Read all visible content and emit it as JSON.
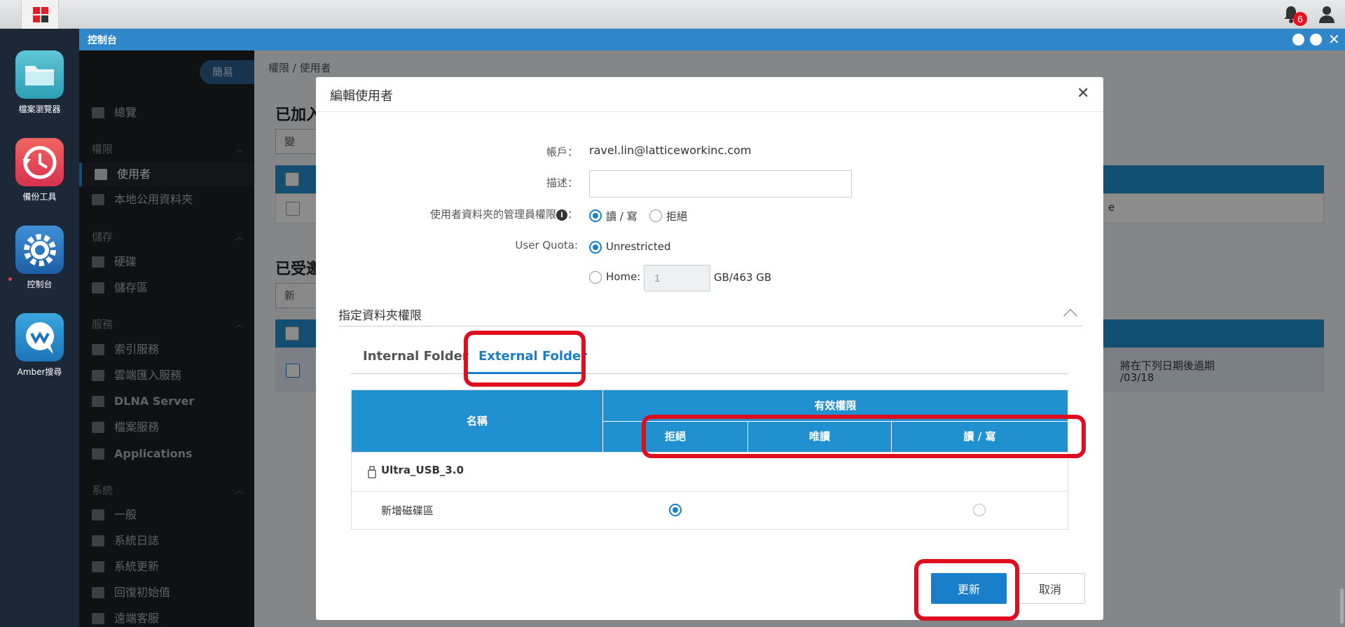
{
  "topbar": {
    "notification_count": "6"
  },
  "dock": {
    "apps": [
      {
        "label": "檔案瀏覽器"
      },
      {
        "label": "備份工具"
      },
      {
        "label": "控制台"
      },
      {
        "label": "Amber搜尋"
      }
    ]
  },
  "window": {
    "title": "控制台"
  },
  "sidebar": {
    "mode_label": "簡易",
    "overview": "總覽",
    "groups": {
      "permissions": "權限",
      "storage": "儲存",
      "services": "服務",
      "system": "系統"
    },
    "items": {
      "users": "使用者",
      "local_shared": "本地公用資料夾",
      "disks": "硬碟",
      "storage_pool": "儲存區",
      "index_service": "索引服務",
      "cloud_import": "雲端匯入服務",
      "dlna": "DLNA Server",
      "file_service": "檔案服務",
      "applications": "Applications",
      "general": "一般",
      "system_log": "系統日誌",
      "system_update": "系統更新",
      "reset": "回復初始值",
      "remote_support": "遠端客服"
    }
  },
  "main": {
    "breadcrumb": "權限 / 使用者",
    "heading1": "已加入",
    "heading2": "已受邀",
    "btn1": "變",
    "btn2": "新",
    "row1_tail": "e",
    "row2_text1": "將在下列日期後過期",
    "row2_text2": "/03/18"
  },
  "dialog": {
    "title": "編輯使用者",
    "account_label": "帳戶：",
    "account_value": "ravel.lin@latticeworkinc.com",
    "description_label": "描述：",
    "description_value": "",
    "admin_perm_label": "使用者資料夾的管理員權限",
    "admin_perm_info": "i",
    "admin_perm_colon": "：",
    "admin_perm_options": [
      "讀 / 寫",
      "拒絕"
    ],
    "quota_label": "User Quota:",
    "quota_unrestricted": "Unrestricted",
    "quota_home": "Home:",
    "quota_value": "1",
    "quota_total": "GB/463 GB",
    "section_title": "指定資料夾權限",
    "tabs": [
      "Internal Folder",
      "External Folder"
    ],
    "table": {
      "col_name": "名稱",
      "col_effective": "有效權限",
      "perm_cols": [
        "拒絕",
        "唯讀",
        "讀 / 寫"
      ],
      "device_name": "Ultra_USB_3.0",
      "volume_name": "新增磁碟區"
    },
    "btn_update": "更新",
    "btn_cancel": "取消"
  },
  "colors": {
    "accent": "#1a7fcb",
    "table_header": "#2190d0",
    "annotation": "#e00d1f",
    "window_title": "#2f86c8"
  }
}
